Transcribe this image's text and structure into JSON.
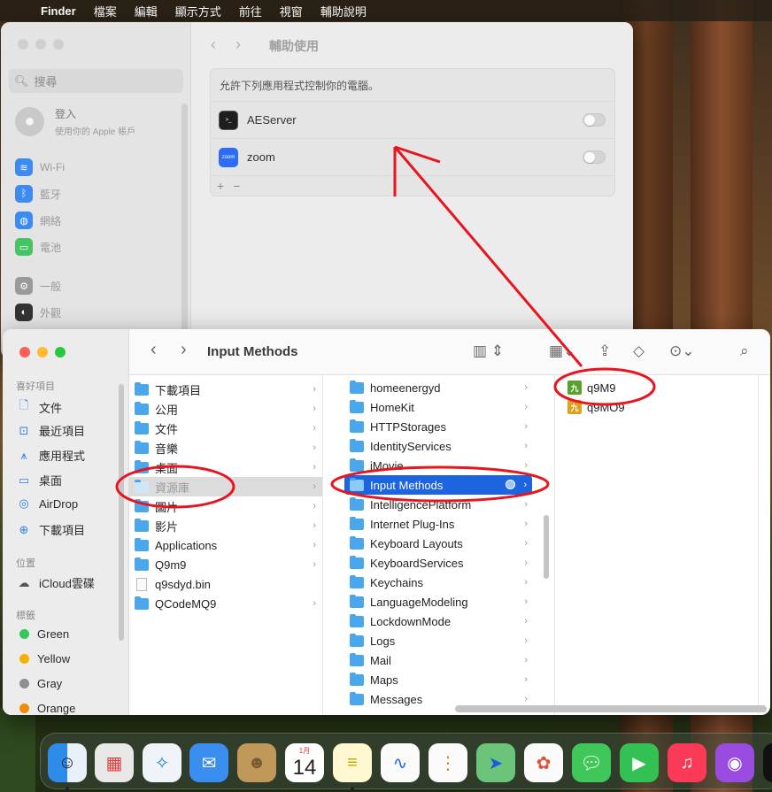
{
  "menubar": {
    "app": "Finder",
    "items": [
      "檔案",
      "編輯",
      "顯示方式",
      "前往",
      "視窗",
      "輔助說明"
    ]
  },
  "settings": {
    "search_placeholder": "搜尋",
    "login_title": "登入",
    "login_sub": "使用你的 Apple 帳戶",
    "sidebar_items": [
      {
        "label": "Wi-Fi",
        "icon": "wifi-icon",
        "color": "#3b8bf0"
      },
      {
        "label": "藍牙",
        "icon": "bluetooth-icon",
        "color": "#3b8bf0"
      },
      {
        "label": "網絡",
        "icon": "globe-icon",
        "color": "#3b8bf0"
      },
      {
        "label": "電池",
        "icon": "battery-icon",
        "color": "#46c463"
      },
      {
        "label": "一般",
        "icon": "gear-icon",
        "color": "#9a9a9a"
      },
      {
        "label": "外觀",
        "icon": "appearance-icon",
        "color": "#333333"
      }
    ],
    "title": "輔助使用",
    "prompt": "允許下列應用程式控制你的電腦。",
    "apps": [
      {
        "name": "AEServer",
        "enabled": false
      },
      {
        "name": "zoom",
        "enabled": false
      }
    ],
    "add": "+",
    "remove": "−"
  },
  "finder": {
    "title": "Input Methods",
    "sections": {
      "favorites": "喜好項目",
      "locations": "位置",
      "tags": "標籤"
    },
    "favorites": [
      {
        "label": "文件",
        "icon": "document-icon"
      },
      {
        "label": "最近項目",
        "icon": "clock-icon"
      },
      {
        "label": "應用程式",
        "icon": "applications-icon"
      },
      {
        "label": "桌面",
        "icon": "desktop-icon"
      },
      {
        "label": "AirDrop",
        "icon": "airdrop-icon"
      },
      {
        "label": "下載項目",
        "icon": "download-icon"
      }
    ],
    "locations": [
      {
        "label": "iCloud雲碟",
        "icon": "cloud-icon"
      }
    ],
    "tags": [
      {
        "label": "Green",
        "color": "#34c759"
      },
      {
        "label": "Yellow",
        "color": "#f0b400"
      },
      {
        "label": "Gray",
        "color": "#8e8e93"
      },
      {
        "label": "Orange",
        "color": "#f08c00"
      }
    ],
    "col1": [
      "下載項目",
      "公用",
      "文件",
      "音樂",
      "桌面",
      "資源庫",
      "圖片",
      "影片",
      "Applications",
      "Q9m9",
      "q9sdyd.bin",
      "QCodeMQ9"
    ],
    "col2": [
      "homeenergyd",
      "HomeKit",
      "HTTPStorages",
      "IdentityServices",
      "iMovie",
      "Input Methods",
      "IntelligencePlatform",
      "Internet Plug-Ins",
      "Keyboard Layouts",
      "KeyboardServices",
      "Keychains",
      "LanguageModeling",
      "LockdownMode",
      "Logs",
      "Mail",
      "Maps",
      "Messages"
    ],
    "col3": [
      "q9M9",
      "q9MO9"
    ]
  },
  "dock": {
    "calendar_month": "1月",
    "calendar_day": "14",
    "apps": [
      "finder-icon",
      "launchpad-icon",
      "safari-icon",
      "mail-icon",
      "contacts-icon",
      "calendar-icon",
      "notes-icon",
      "freeform-icon",
      "reminders-icon",
      "maps-icon",
      "photos-icon",
      "messages-icon",
      "facetime-icon",
      "music-icon",
      "podcasts-icon",
      "tv-icon"
    ]
  },
  "colors": {
    "selection": "#1c64e0",
    "annotation": "#e8141e"
  }
}
